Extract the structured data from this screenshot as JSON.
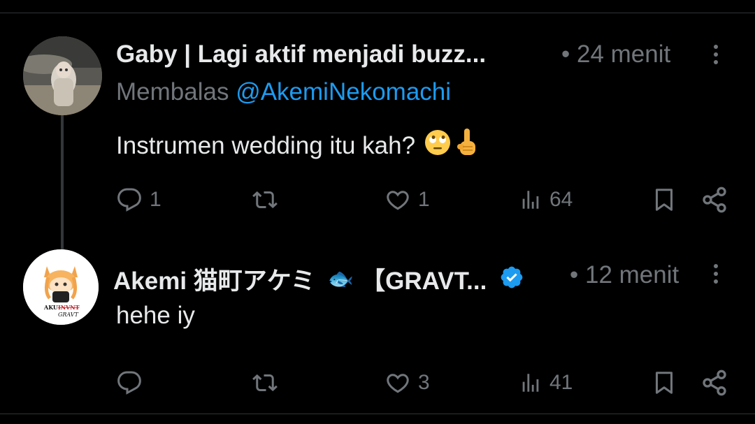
{
  "colors": {
    "background": "#000000",
    "text_primary": "#e7e9ea",
    "text_secondary": "#71767b",
    "link": "#1d9bf0",
    "verified_badge": "#1d9bf0",
    "divider": "#2f3336"
  },
  "tweets": [
    {
      "display_name": "Gaby | Lagi aktif menjadi buzz...",
      "time": "• 24 menit",
      "reply_prefix": "Membalas",
      "reply_handle": "@AkemiNekomachi",
      "text": "Instrumen wedding itu kah?",
      "emojis": [
        "face-with-rolling-eyes",
        "index-pointing-up"
      ],
      "actions": {
        "reply_count": "1",
        "retweet_count": "",
        "like_count": "1",
        "view_count": "64"
      },
      "icons": [
        "reply-icon",
        "retweet-icon",
        "like-icon",
        "views-icon",
        "bookmark-icon",
        "share-icon",
        "more-icon"
      ]
    },
    {
      "display_name": "Akemi 猫町アケミ",
      "name_emoji": "🐟",
      "display_name_suffix": "【GRAVT...",
      "verified": true,
      "time": "• 12 menit",
      "text": "hehe iy",
      "avatar_text": {
        "line1": "AKU",
        "line2": "INVNT",
        "line3": "GRAVT"
      },
      "actions": {
        "reply_count": "",
        "retweet_count": "",
        "like_count": "3",
        "view_count": "41"
      },
      "icons": [
        "reply-icon",
        "retweet-icon",
        "like-icon",
        "views-icon",
        "bookmark-icon",
        "share-icon",
        "more-icon"
      ]
    }
  ]
}
